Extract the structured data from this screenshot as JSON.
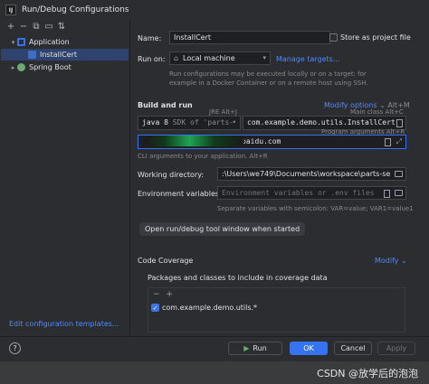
{
  "window": {
    "title": "Run/Debug Configurations",
    "app_icon": "IJ"
  },
  "tree": {
    "items": [
      {
        "label": "Application",
        "expanded": true
      },
      {
        "label": "InstallCert",
        "selected": true
      },
      {
        "label": "Spring Boot",
        "expanded": false
      }
    ],
    "edit_templates": "Edit configuration templates..."
  },
  "form": {
    "name_label": "Name:",
    "name_value": "InstallCert",
    "store_label": "Store as project file",
    "run_on_label": "Run on:",
    "run_on_value": "Local machine",
    "manage_targets": "Manage targets...",
    "run_on_hint_1": "Run configurations may be executed locally or on a target: for",
    "run_on_hint_2": "example in a Docker Container or on a remote host using SSH.",
    "build_run_label": "Build and run",
    "modify_options": "Modify options",
    "modify_shortcut": "Alt+M",
    "jre_hint": "JRE Alt+J",
    "main_class_hint": "Main class Alt+C",
    "jdk_value": "java 8",
    "jdk_detail": "SDK of 'parts-",
    "main_class_value": "com.example.demo.utils.InstallCert",
    "program_args_hint": "Program arguments Alt+R",
    "program_args_value": "baidu.com",
    "cli_hint": "CLI arguments to your application. Alt+R",
    "workdir_label": "Working directory:",
    "workdir_value": ":\\Users\\we749\\Documents\\workspace\\parts-se",
    "env_label": "Environment variables:",
    "env_placeholder": "Environment variables or .env files",
    "env_hint": "Separate variables with semicolon: VAR=value; VAR1=value1",
    "open_tool_window": "Open run/debug tool window when started",
    "code_coverage_label": "Code Coverage",
    "modify_label": "Modify",
    "packages_label": "Packages and classes to include in coverage data",
    "coverage_item": "com.example.demo.utils.*"
  },
  "buttons": {
    "help": "?",
    "run": "Run",
    "ok": "OK",
    "cancel": "Cancel",
    "apply": "Apply"
  },
  "watermark": "CSDN @放学后的泡泡",
  "colors": {
    "accent": "#3574f0",
    "link": "#548af7",
    "run_green": "#5fb865",
    "background": "#2b2d30"
  }
}
